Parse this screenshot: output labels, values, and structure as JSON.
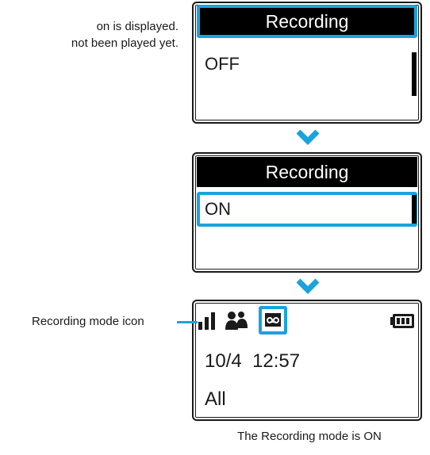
{
  "note": {
    "line1": "on is displayed.",
    "line2": "not been played yet."
  },
  "screen1": {
    "title": "Recording",
    "option": "OFF"
  },
  "screen2": {
    "title": "Recording",
    "option": "ON"
  },
  "screen3": {
    "status_icons": [
      "signal-strength-icon",
      "people-icon",
      "recording-mode-icon",
      "battery-icon"
    ],
    "date": "10/4",
    "time": "12:57",
    "filter": "All"
  },
  "callout": {
    "label": "Recording mode icon"
  },
  "caption": "The Recording mode is ON",
  "colors": {
    "highlight": "#1aa3dc",
    "titlebar": "#000000",
    "text": "#1a1a1a"
  }
}
